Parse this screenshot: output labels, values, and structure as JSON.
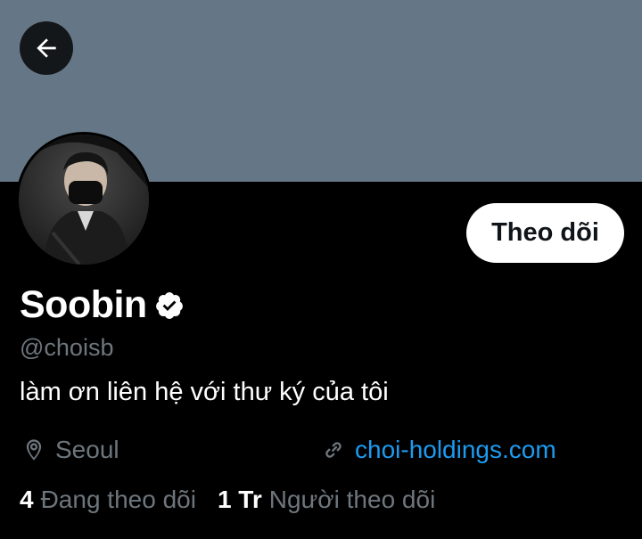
{
  "profile": {
    "display_name": "Soobin",
    "handle": "@choisb",
    "bio": "làm ơn liên hệ với thư ký của tôi",
    "location": "Seoul",
    "website": "choi-holdings.com",
    "verified": true
  },
  "actions": {
    "follow_label": "Theo dõi"
  },
  "stats": {
    "following_count": "4",
    "following_label": "Đang theo dõi",
    "followers_count": "1 Tr",
    "followers_label": "Người theo dõi"
  },
  "icons": {
    "back": "arrow-left-icon",
    "verified": "verified-badge-icon",
    "location": "location-pin-icon",
    "link": "link-icon"
  },
  "colors": {
    "banner": "#657786",
    "background": "#000000",
    "link": "#1d9bf0",
    "secondary_text": "#6e767d",
    "follow_button_bg": "#ffffff"
  }
}
